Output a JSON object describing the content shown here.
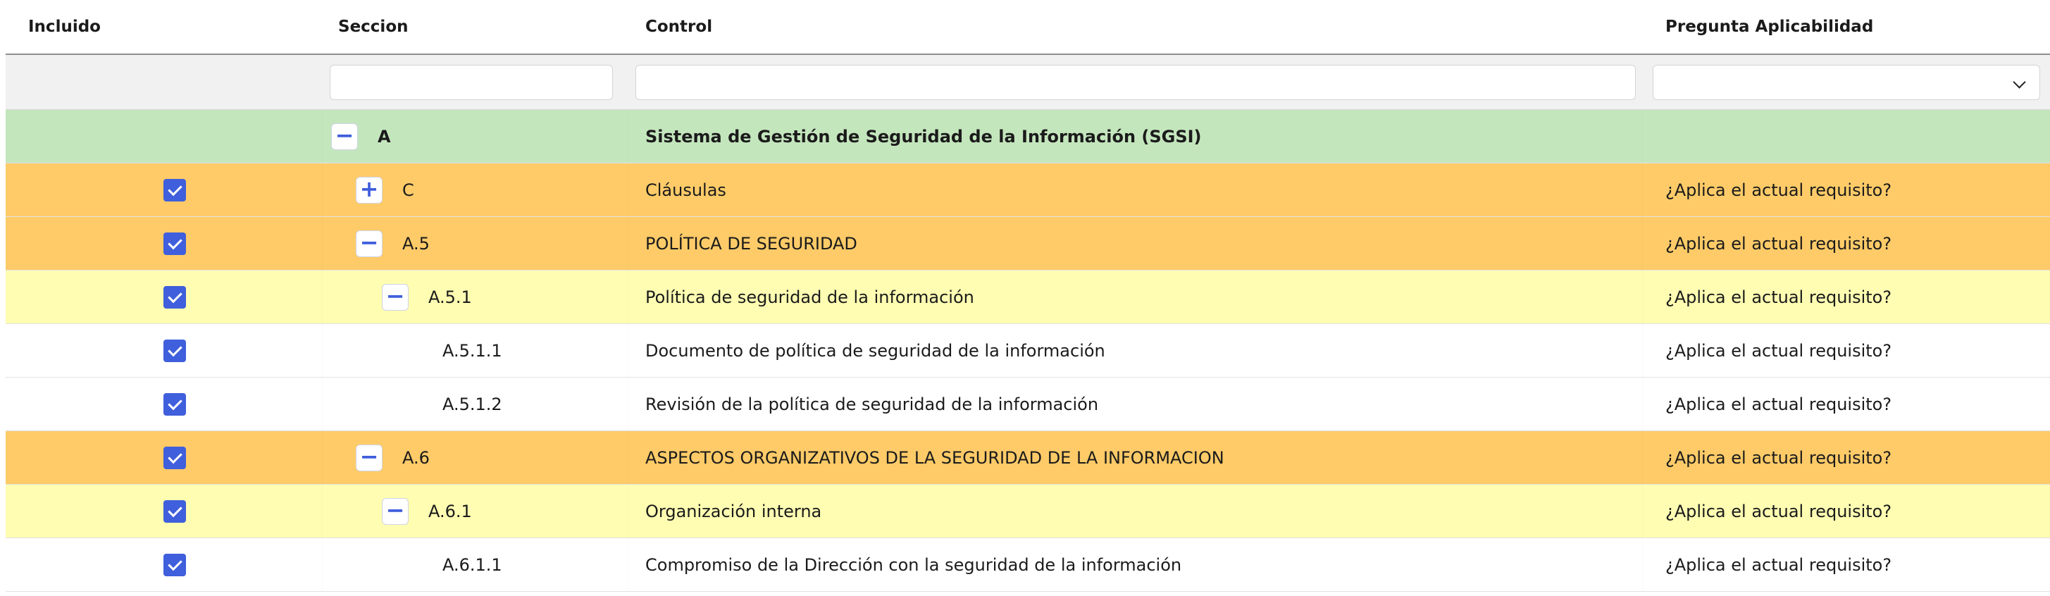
{
  "columns": {
    "included": "Incluido",
    "section": "Seccion",
    "control": "Control",
    "question": "Pregunta Aplicabilidad"
  },
  "filters": {
    "section_value": "",
    "control_value": "",
    "question_selected": ""
  },
  "rows": [
    {
      "section": "A",
      "control": "Sistema de Gestión de Seguridad de la Información (SGSI)",
      "question": "",
      "toggle": "−",
      "checked": false,
      "color": "green"
    },
    {
      "section": "C",
      "control": "Cláusulas",
      "question": "¿Aplica el actual requisito?",
      "toggle": "+",
      "checked": true,
      "color": "orange"
    },
    {
      "section": "A.5",
      "control": "POLÍTICA DE SEGURIDAD",
      "question": "¿Aplica el actual requisito?",
      "toggle": "−",
      "checked": true,
      "color": "orange"
    },
    {
      "section": "A.5.1",
      "control": "Política de seguridad de la información",
      "question": "¿Aplica el actual requisito?",
      "toggle": "−",
      "checked": true,
      "color": "yellow"
    },
    {
      "section": "A.5.1.1",
      "control": "Documento de política de seguridad de la información",
      "question": "¿Aplica el actual requisito?",
      "toggle": "",
      "checked": true,
      "color": "white"
    },
    {
      "section": "A.5.1.2",
      "control": "Revisión de la política de seguridad de la información",
      "question": "¿Aplica el actual requisito?",
      "toggle": "",
      "checked": true,
      "color": "white"
    },
    {
      "section": "A.6",
      "control": "ASPECTOS ORGANIZATIVOS DE LA SEGURIDAD DE LA INFORMACION",
      "question": "¿Aplica el actual requisito?",
      "toggle": "−",
      "checked": true,
      "color": "orange"
    },
    {
      "section": "A.6.1",
      "control": "Organización interna",
      "question": "¿Aplica el actual requisito?",
      "toggle": "−",
      "checked": true,
      "color": "yellow"
    },
    {
      "section": "A.6.1.1",
      "control": "Compromiso de la Dirección con la seguridad de la información",
      "question": "¿Aplica el actual requisito?",
      "toggle": "",
      "checked": true,
      "color": "white"
    }
  ],
  "colors": {
    "green": "#c4e6bd",
    "orange": "#fecb68",
    "yellow": "#fefdb2",
    "accent": "#3f5fdc"
  }
}
